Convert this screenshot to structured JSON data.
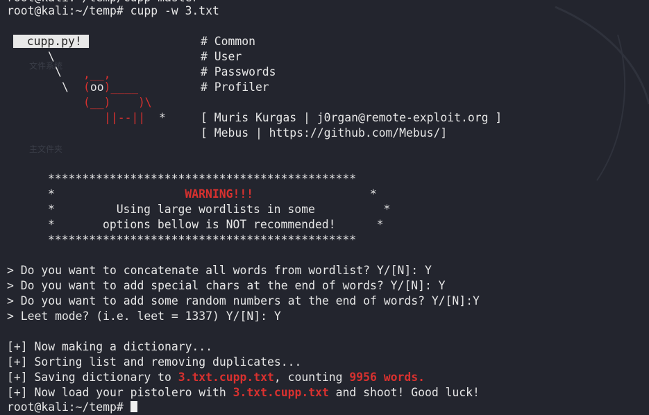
{
  "top_cut_line": "root@kali:~/temp/cupp-master",
  "prompt_line": "root@kali:~/temp# cupp -w 3.txt",
  "banner": {
    "underline": "___________",
    "box_label": "cupp.py!",
    "header_items": [
      "# Common",
      "# User",
      "# Passwords",
      "# Profiler"
    ],
    "credit1": "[ Muris Kurgas | j0rgan@remote-exploit.org ]",
    "credit2": "[ Mebus | https://github.com/Mebus/]",
    "art_slash1": "\\",
    "art_slash2": "\\",
    "art_slash3": "\\",
    "cow_top": ",__,",
    "cow_eyes": "(oo)____",
    "cow_mid": "(__)    )\\",
    "cow_legs": "||--||",
    "cow_star": "*"
  },
  "warning": {
    "border": "*********************************************",
    "title": "WARNING!!!",
    "line1": "Using large wordlists in some",
    "line2": "options bellow is NOT recommended!"
  },
  "questions": [
    "> Do you want to concatenate all words from wordlist? Y/[N]: Y",
    "> Do you want to add special chars at the end of words? Y/[N]: Y",
    "> Do you want to add some random numbers at the end of words? Y/[N]:Y",
    "> Leet mode? (i.e. leet = 1337) Y/[N]: Y"
  ],
  "output": {
    "making": "[+] Now making a dictionary...",
    "sorting": "[+] Sorting list and removing duplicates...",
    "saving_prefix": "[+] Saving dictionary to ",
    "saving_file": "3.txt.cupp.txt",
    "saving_mid": ", counting ",
    "saving_count": "9956 words.",
    "load_prefix": "[+] Now load your pistolero with ",
    "load_file": "3.txt.cupp.txt",
    "load_suffix": " and shoot! Good luck!"
  },
  "final_prompt": "root@kali:~/temp# ",
  "desktop_watermarks": [
    "文件系统",
    "主文件夹"
  ],
  "colors": {
    "background": "#23252e",
    "text": "#e6e6e6",
    "accent_red": "#d8312f"
  }
}
